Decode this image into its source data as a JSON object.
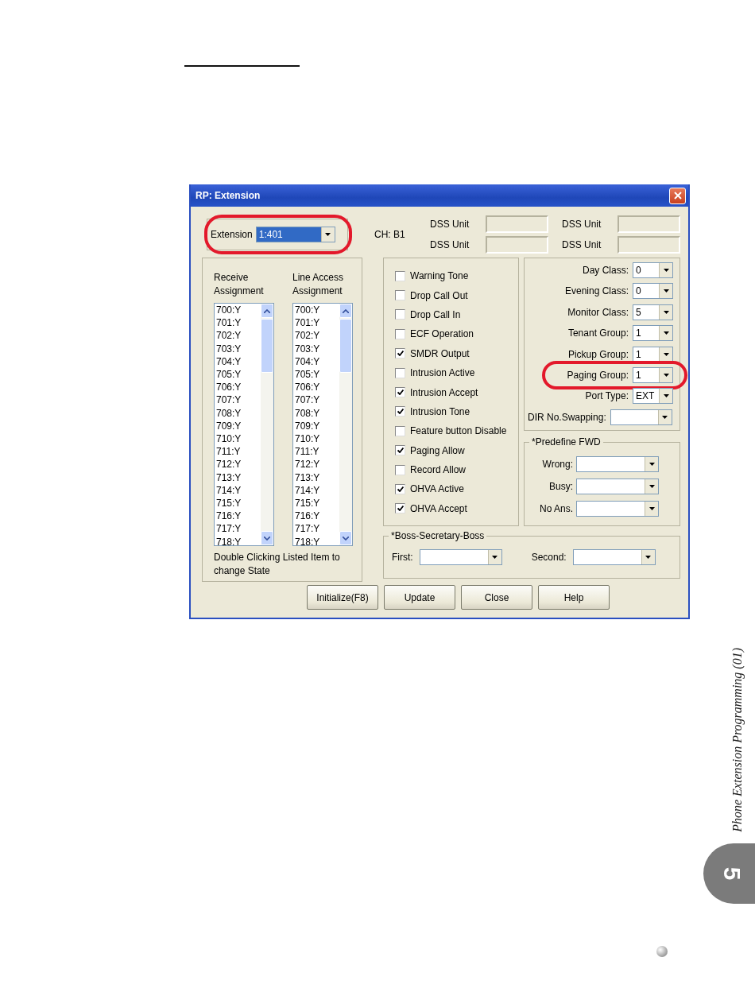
{
  "window": {
    "title": "RP: Extension"
  },
  "extension": {
    "label": "Extension",
    "value": "1:401",
    "circled": true
  },
  "channel": "CH: B1",
  "dss_units": [
    {
      "label": "DSS Unit"
    },
    {
      "label": "DSS Unit"
    },
    {
      "label": "DSS Unit"
    },
    {
      "label": "DSS Unit"
    }
  ],
  "lists": [
    {
      "heading": "Receive Assignment",
      "items": [
        "700:Y",
        "701:Y",
        "702:Y",
        "703:Y",
        "704:Y",
        "705:Y",
        "706:Y",
        "707:Y",
        "708:Y",
        "709:Y",
        "710:Y",
        "711:Y",
        "712:Y",
        "713:Y",
        "714:Y",
        "715:Y",
        "716:Y",
        "717:Y",
        "718:Y"
      ]
    },
    {
      "heading": "Line Access Assignment",
      "items": [
        "700:Y",
        "701:Y",
        "702:Y",
        "703:Y",
        "704:Y",
        "705:Y",
        "706:Y",
        "707:Y",
        "708:Y",
        "709:Y",
        "710:Y",
        "711:Y",
        "712:Y",
        "713:Y",
        "714:Y",
        "715:Y",
        "716:Y",
        "717:Y",
        "718:Y"
      ]
    }
  ],
  "list_hint": "Double Clicking Listed Item to change State",
  "options": [
    {
      "label": "Warning Tone",
      "checked": false
    },
    {
      "label": "Drop Call Out",
      "checked": false
    },
    {
      "label": "Drop Call In",
      "checked": false
    },
    {
      "label": "ECF Operation",
      "checked": false
    },
    {
      "label": "SMDR Output",
      "checked": true
    },
    {
      "label": "Intrusion Active",
      "checked": false
    },
    {
      "label": "Intrusion Accept",
      "checked": true
    },
    {
      "label": "Intrusion Tone",
      "checked": true
    },
    {
      "label": "Feature button Disable",
      "checked": false
    },
    {
      "label": "Paging Allow",
      "checked": true
    },
    {
      "label": "Record Allow",
      "checked": false
    },
    {
      "label": "OHVA Active",
      "checked": true
    },
    {
      "label": "OHVA Accept",
      "checked": true
    }
  ],
  "classes": [
    {
      "label": "Day Class:",
      "value": "0",
      "circled": false
    },
    {
      "label": "Evening Class:",
      "value": "0",
      "circled": false
    },
    {
      "label": "Monitor Class:",
      "value": "5",
      "circled": false
    },
    {
      "label": "Tenant Group:",
      "value": "1",
      "circled": false
    },
    {
      "label": "Pickup Group:",
      "value": "1",
      "circled": false
    },
    {
      "label": "Paging Group:",
      "value": "1",
      "circled": true
    },
    {
      "label": "Port Type:",
      "value": "EXT",
      "circled": false
    }
  ],
  "dir_swapping": {
    "label": "DIR No.Swapping:"
  },
  "predefine_fwd": {
    "title": "*Predefine FWD",
    "fields": [
      {
        "label": "Wrong:"
      },
      {
        "label": "Busy:"
      },
      {
        "label": "No Ans."
      }
    ]
  },
  "boss_secretary": {
    "title": "*Boss-Secretary-Boss",
    "fields": [
      {
        "label": "First:"
      },
      {
        "label": "Second:"
      }
    ]
  },
  "buttons": [
    "Initialize(F8)",
    "Update",
    "Close",
    "Help"
  ],
  "side_tab": {
    "title": "Phone Extension Programming (01)",
    "chapter": "5"
  }
}
